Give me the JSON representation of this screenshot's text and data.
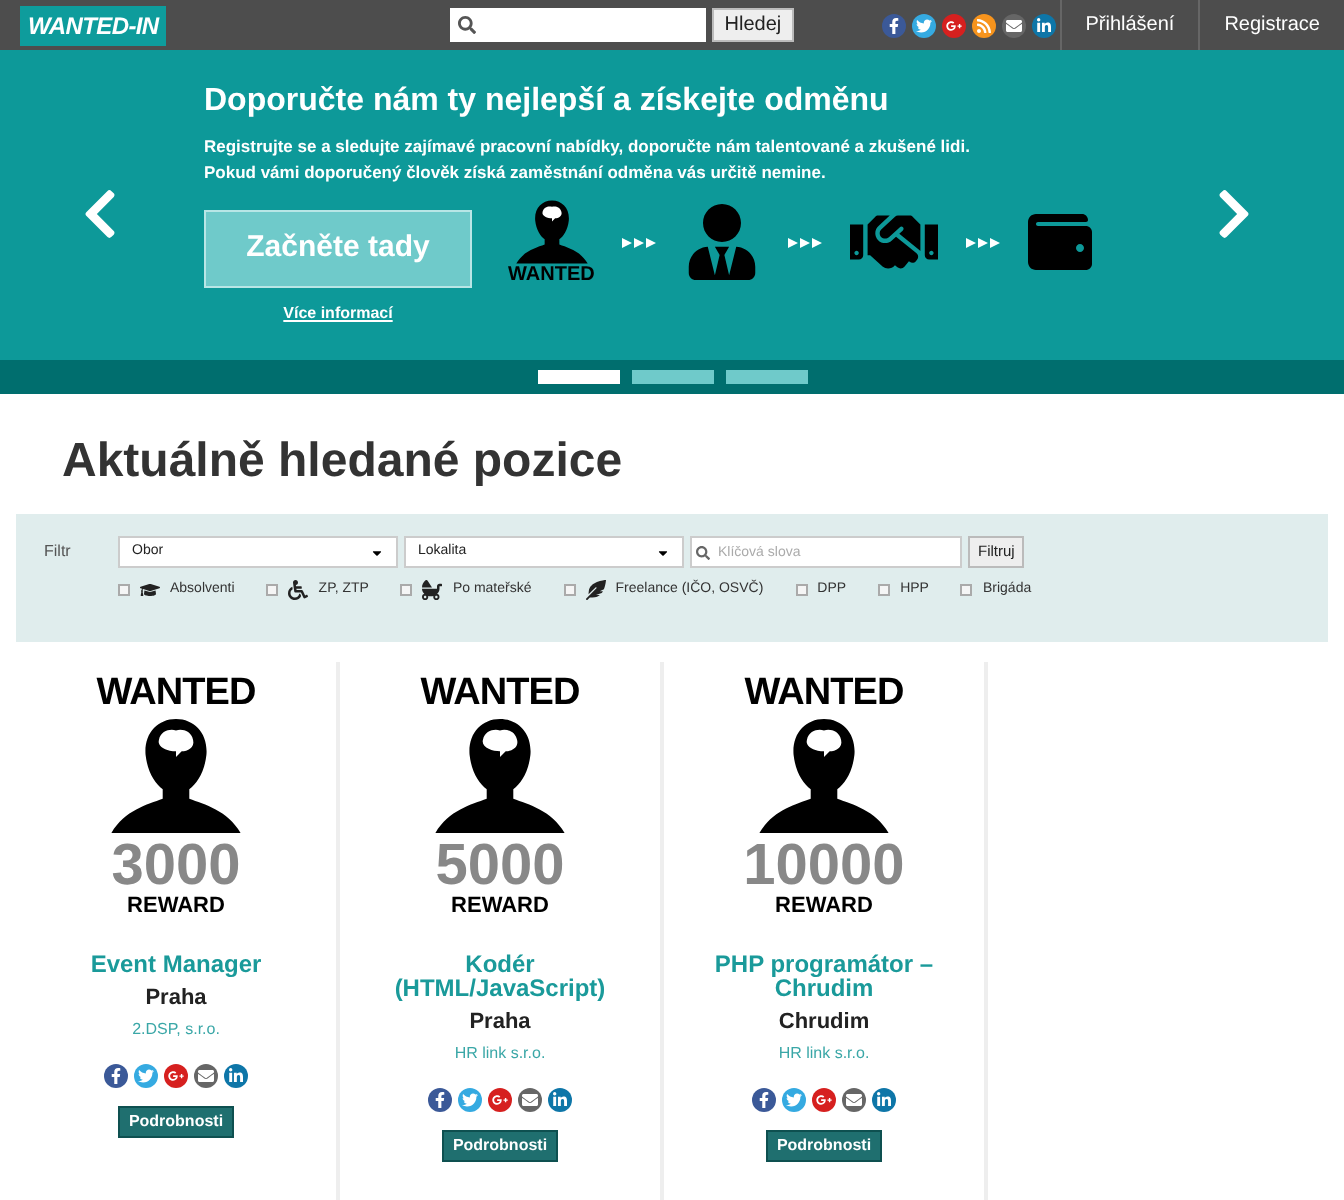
{
  "header": {
    "logo": "WANTED-IN",
    "search_button": "Hledej",
    "social": [
      {
        "kind": "facebook"
      },
      {
        "kind": "twitter"
      },
      {
        "kind": "gplus"
      },
      {
        "kind": "rss"
      },
      {
        "kind": "mail"
      },
      {
        "kind": "linkedin"
      }
    ],
    "nav": [
      "Přihlášení",
      "Registrace"
    ]
  },
  "hero": {
    "title": "Doporučte nám ty nejlepší a získejte odměnu",
    "text": [
      "Registrujte se a sledujte zajímavé pracovní nabídky, doporučte nám talentované a zkušené lidi.",
      "Pokud vámi doporučený člověk získá zaměstnání odměna vás určitě nemine."
    ],
    "cta": "Začněte tady",
    "more_link": "Více informací",
    "wanted_label": "WANTED",
    "slides": [
      {
        "selected": true
      },
      {
        "selected": false
      },
      {
        "selected": false
      }
    ]
  },
  "heading": "Aktuálně hledané pozice",
  "filter": {
    "label": "Filtr",
    "selects": [
      "Obor",
      "Lokalita"
    ],
    "keyword_placeholder": "Klíčová slova",
    "button": "Filtruj",
    "options": [
      {
        "label": "Absolventi",
        "checked": false,
        "kind": "graduate"
      },
      {
        "label": "ZP, ZTP",
        "checked": false,
        "kind": "wheelchair"
      },
      {
        "label": "Po mateřské",
        "checked": false,
        "kind": "stroller"
      },
      {
        "label": "Freelance (IČO, OSVČ)",
        "checked": false,
        "kind": "feather"
      },
      {
        "label": "DPP",
        "checked": false,
        "kind": "plain"
      },
      {
        "label": "HPP",
        "checked": false,
        "kind": "plain"
      },
      {
        "label": "Brigáda",
        "checked": false,
        "kind": "plain"
      }
    ]
  },
  "jobs": [
    {
      "wanted": "WANTED",
      "reward": "3000",
      "reward_label": "REWARD",
      "title": "Event Manager",
      "city": "Praha",
      "company": "2.DSP, s.r.o.",
      "social": [
        {
          "kind": "facebook"
        },
        {
          "kind": "twitter"
        },
        {
          "kind": "gplus"
        },
        {
          "kind": "mail"
        },
        {
          "kind": "linkedin"
        }
      ],
      "button": "Podrobnosti"
    },
    {
      "wanted": "WANTED",
      "reward": "5000",
      "reward_label": "REWARD",
      "title": "Kodér (HTML/JavaScript)",
      "city": "Praha",
      "company": "HR link s.r.o.",
      "social": [
        {
          "kind": "facebook"
        },
        {
          "kind": "twitter"
        },
        {
          "kind": "gplus"
        },
        {
          "kind": "mail"
        },
        {
          "kind": "linkedin"
        }
      ],
      "button": "Podrobnosti"
    },
    {
      "wanted": "WANTED",
      "reward": "10000",
      "reward_label": "REWARD",
      "title": "PHP programátor – Chrudim",
      "city": "Chrudim",
      "company": "HR link s.r.o.",
      "social": [
        {
          "kind": "facebook"
        },
        {
          "kind": "twitter"
        },
        {
          "kind": "gplus"
        },
        {
          "kind": "mail"
        },
        {
          "kind": "linkedin"
        }
      ],
      "button": "Podrobnosti"
    }
  ]
}
